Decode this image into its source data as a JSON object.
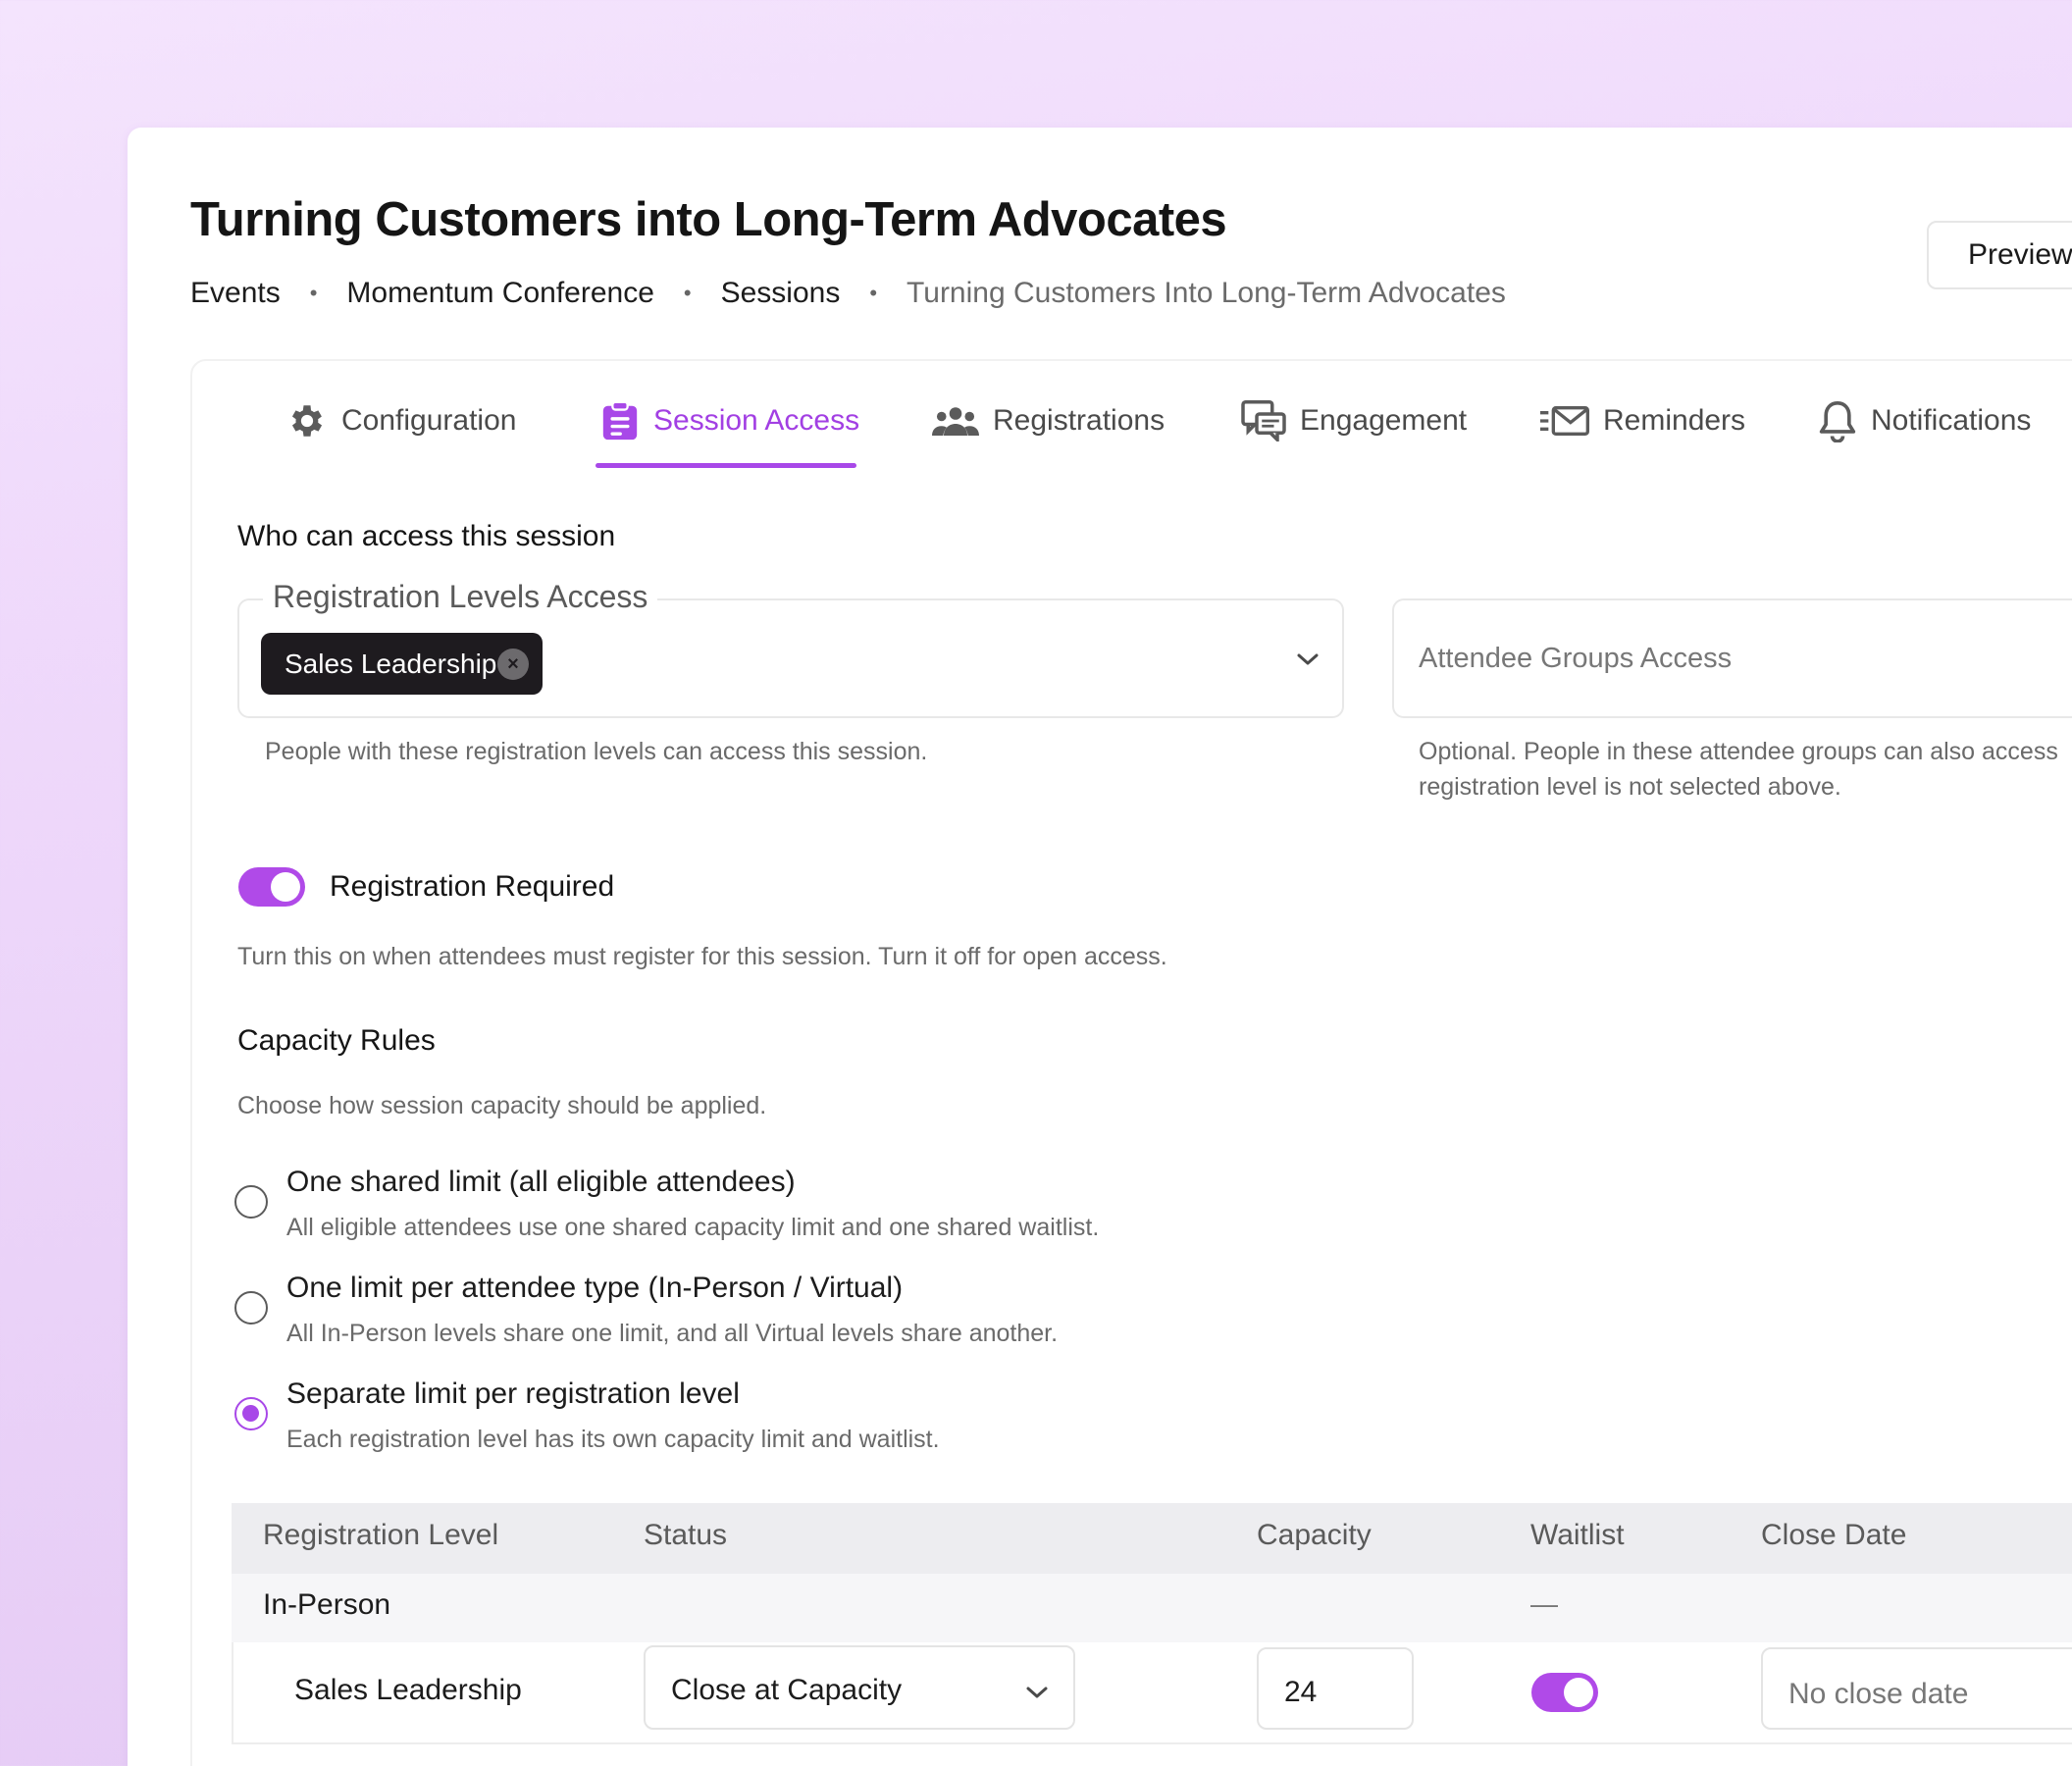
{
  "header": {
    "title": "Turning Customers into Long-Term Advocates",
    "preview_label": "Preview"
  },
  "breadcrumb": [
    "Events",
    "Momentum Conference",
    "Sessions",
    "Turning Customers Into Long-Term Advocates"
  ],
  "tabs": [
    {
      "label": "Configuration",
      "icon": "gear-icon",
      "active": false
    },
    {
      "label": "Session Access",
      "icon": "clipboard-icon",
      "active": true
    },
    {
      "label": "Registrations",
      "icon": "users-icon",
      "active": false
    },
    {
      "label": "Engagement",
      "icon": "chat-icon",
      "active": false
    },
    {
      "label": "Reminders",
      "icon": "envelope-icon",
      "active": false
    },
    {
      "label": "Notifications",
      "icon": "bell-icon",
      "active": false
    }
  ],
  "access": {
    "heading": "Who can access this session",
    "registration_levels": {
      "legend": "Registration Levels Access",
      "chips": [
        "Sales Leadership"
      ],
      "helper": "People with these registration levels can access this session."
    },
    "attendee_groups": {
      "placeholder": "Attendee Groups Access",
      "helper_line1": "Optional. People in these attendee groups can also access",
      "helper_line2": "registration level is not selected above."
    }
  },
  "registration_required": {
    "label": "Registration Required",
    "enabled": true,
    "helper": "Turn this on when attendees must register for this session. Turn it off for open access."
  },
  "capacity": {
    "heading": "Capacity Rules",
    "helper": "Choose how session capacity should be applied.",
    "options": [
      {
        "label": "One shared limit (all eligible attendees)",
        "desc": "All eligible attendees use one shared capacity limit and one shared waitlist.",
        "selected": false
      },
      {
        "label": "One limit per attendee type (In-Person / Virtual)",
        "desc": "All In-Person levels share one limit, and all Virtual levels share another.",
        "selected": false
      },
      {
        "label": "Separate limit per registration level",
        "desc": "Each registration level has its own capacity limit and waitlist.",
        "selected": true
      }
    ]
  },
  "table": {
    "columns": [
      "Registration Level",
      "Status",
      "Capacity",
      "Waitlist",
      "Close Date"
    ],
    "group": {
      "label": "In-Person",
      "waitlist": "—"
    },
    "rows": [
      {
        "level": "Sales Leadership",
        "status": "Close at Capacity",
        "capacity": "24",
        "waitlist": true,
        "close_date_placeholder": "No close date"
      }
    ]
  },
  "colors": {
    "accent": "#a848e8",
    "chip_bg": "#1e1b1f"
  }
}
